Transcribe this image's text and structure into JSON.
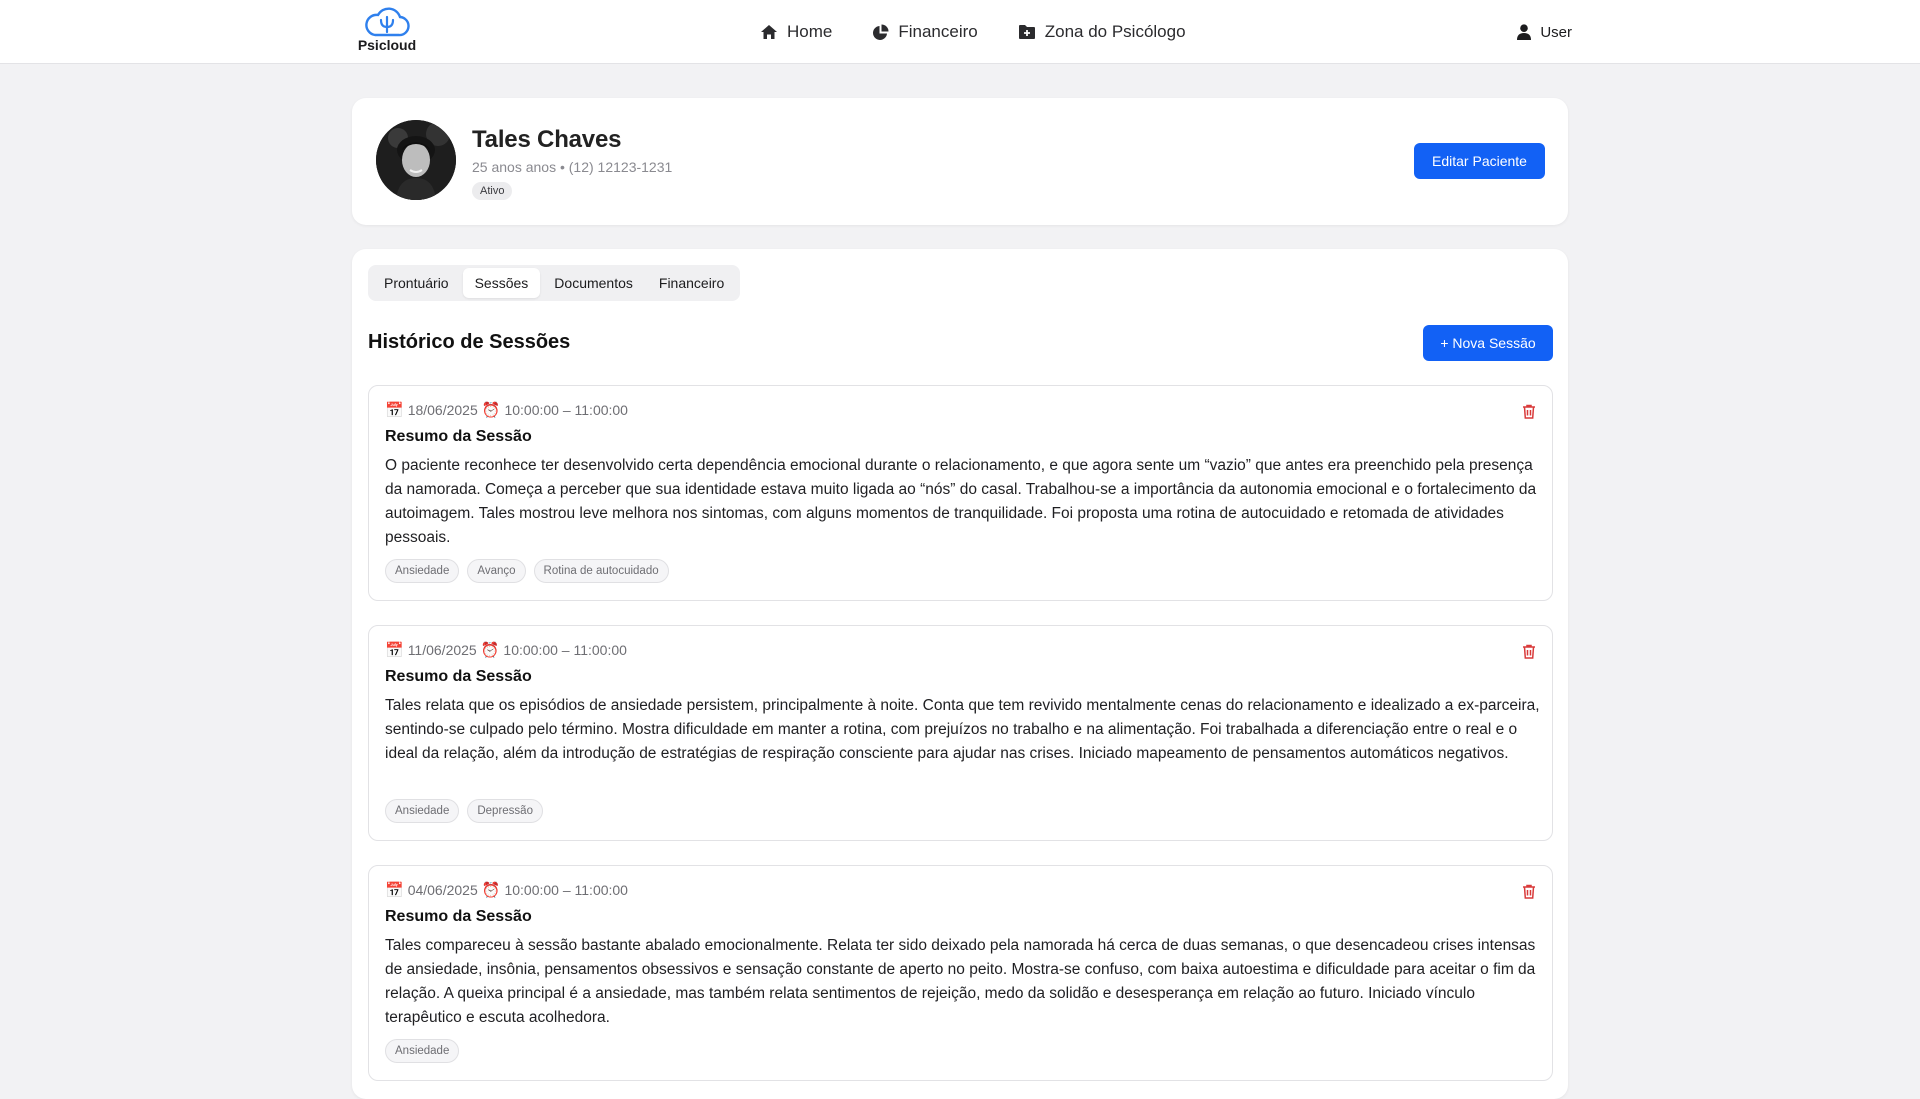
{
  "brand": {
    "name": "Psicloud"
  },
  "nav": {
    "items": [
      {
        "label": "Home",
        "icon": "home-icon"
      },
      {
        "label": "Financeiro",
        "icon": "pie-chart-icon"
      },
      {
        "label": "Zona do Psicólogo",
        "icon": "folder-plus-icon"
      }
    ],
    "user_label": "User"
  },
  "patient": {
    "name": "Tales Chaves",
    "age": "25 anos anos",
    "separator": "•",
    "phone": "(12) 12123-1231",
    "status": "Ativo",
    "edit_label": "Editar Paciente"
  },
  "tabs": [
    {
      "label": "Prontuário",
      "active": false
    },
    {
      "label": "Sessões",
      "active": true
    },
    {
      "label": "Documentos",
      "active": false
    },
    {
      "label": "Financeiro",
      "active": false
    }
  ],
  "sessions_section": {
    "title": "Histórico de Sessões",
    "new_label": "+ Nova Sessão",
    "summary_title": "Resumo da Sessão"
  },
  "sessions": [
    {
      "date": "18/06/2025",
      "time": "10:00:00 – 11:00:00",
      "text": "O paciente reconhece ter desenvolvido certa dependência emocional durante o relacionamento, e que agora sente um “vazio” que antes era preenchido pela presença da namorada. Começa a perceber que sua identidade estava muito ligada ao “nós” do casal. Trabalhou-se a importância da autonomia emocional e o fortalecimento da autoimagem. Tales mostrou leve melhora nos sintomas, com alguns momentos de tranquilidade. Foi proposta uma rotina de autocuidado e retomada de atividades pessoais.",
      "tags": [
        "Ansiedade",
        "Avanço",
        "Rotina de autocuidado"
      ]
    },
    {
      "date": "11/06/2025",
      "time": "10:00:00 – 11:00:00",
      "text": "Tales relata que os episódios de ansiedade persistem, principalmente à noite. Conta que tem revivido mentalmente cenas do relacionamento e idealizado a ex-parceira, sentindo-se culpado pelo término. Mostra dificuldade em manter a rotina, com prejuízos no trabalho e na alimentação. Foi trabalhada a diferenciação entre o real e o ideal da relação, além da introdução de estratégias de respiração consciente para ajudar nas crises. Iniciado mapeamento de pensamentos automáticos negativos.",
      "tags": [
        "Ansiedade",
        "Depressão"
      ]
    },
    {
      "date": "04/06/2025",
      "time": "10:00:00 – 11:00:00",
      "text": "Tales compareceu à sessão bastante abalado emocionalmente. Relata ter sido deixado pela namorada há cerca de duas semanas, o que desencadeou crises intensas de ansiedade, insônia, pensamentos obsessivos e sensação constante de aperto no peito. Mostra-se confuso, com baixa autoestima e dificuldade para aceitar o fim da relação. A queixa principal é a ansiedade, mas também relata sentimentos de rejeição, medo da solidão e desesperança em relação ao futuro. Iniciado vínculo terapêutico e escuta acolhedora.",
      "tags": [
        "Ansiedade"
      ]
    }
  ],
  "colors": {
    "primary": "#1261f5",
    "danger": "#d93a3a",
    "brand": "#2f80ed"
  }
}
